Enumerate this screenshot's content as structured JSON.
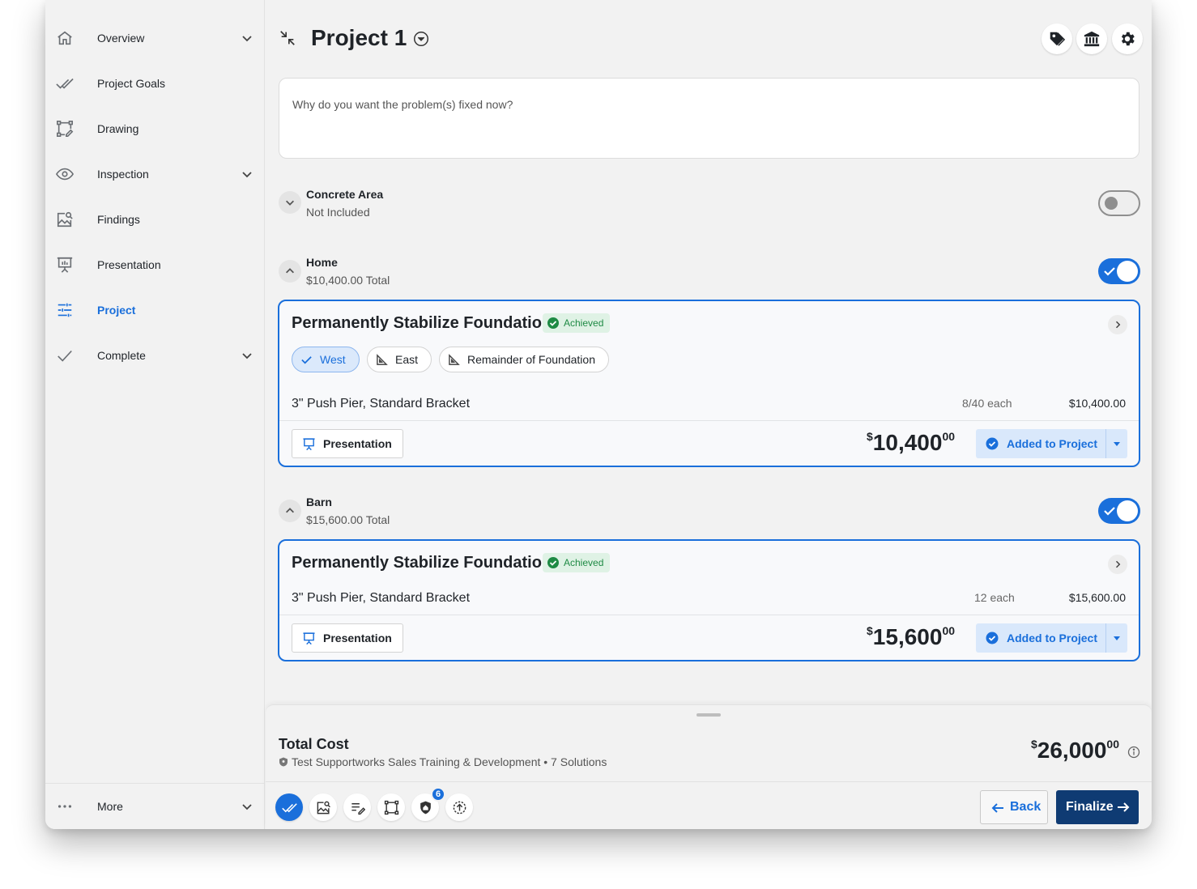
{
  "sidebar": {
    "items": [
      {
        "label": "Overview",
        "icon": "home-icon",
        "chevron": true
      },
      {
        "label": "Project Goals",
        "icon": "double-check-icon",
        "chevron": false
      },
      {
        "label": "Drawing",
        "icon": "drawing-icon",
        "chevron": false
      },
      {
        "label": "Inspection",
        "icon": "eye-icon",
        "chevron": true
      },
      {
        "label": "Findings",
        "icon": "image-search-icon",
        "chevron": false
      },
      {
        "label": "Presentation",
        "icon": "presentation-icon",
        "chevron": false
      },
      {
        "label": "Project",
        "icon": "sliders-icon",
        "chevron": false,
        "active": true
      },
      {
        "label": "Complete",
        "icon": "check-icon",
        "chevron": true
      }
    ],
    "more_label": "More"
  },
  "header": {
    "title": "Project 1"
  },
  "why_box": {
    "placeholder": "Why do you want the problem(s) fixed now?"
  },
  "sections": [
    {
      "title": "Concrete Area",
      "subtitle": "Not Included",
      "enabled": false
    },
    {
      "title": "Home",
      "subtitle": "$10,400.00 Total",
      "enabled": true
    },
    {
      "title": "Barn",
      "subtitle": "$15,600.00 Total",
      "enabled": true
    }
  ],
  "cards": [
    {
      "title": "Permanently Stabilize Foundation",
      "badge": "Achieved",
      "chips": [
        "West",
        "East",
        "Remainder of Foundation"
      ],
      "selected_chip": "West",
      "line": {
        "name": "3\" Push Pier, Standard Bracket",
        "qty": "8/40 each",
        "price": "$10,400.00"
      },
      "presentation_label": "Presentation",
      "price_symbol": "$",
      "price_whole": "10,400",
      "price_cents": "00",
      "added_label": "Added to Project"
    },
    {
      "title": "Permanently Stabilize Foundation",
      "badge": "Achieved",
      "line": {
        "name": "3\" Push Pier, Standard Bracket",
        "qty": "12 each",
        "price": "$15,600.00"
      },
      "presentation_label": "Presentation",
      "price_symbol": "$",
      "price_whole": "15,600",
      "price_cents": "00",
      "added_label": "Added to Project"
    }
  ],
  "total": {
    "label": "Total Cost",
    "subtitle": "Test Supportworks Sales Training & Development • 7 Solutions",
    "price_symbol": "$",
    "price_whole": "26,000",
    "price_cents": "00"
  },
  "toolbar": {
    "tools": [
      "goals-tool",
      "findings-tool",
      "notes-tool",
      "drawing-tool",
      "warranty-tool",
      "upload-tool"
    ],
    "warranty_badge": "6",
    "back_label": "Back",
    "finalize_label": "Finalize"
  },
  "colors": {
    "accent": "#1a6fdb",
    "finalize": "#0f3b73",
    "achieved": "#1e8a44"
  }
}
